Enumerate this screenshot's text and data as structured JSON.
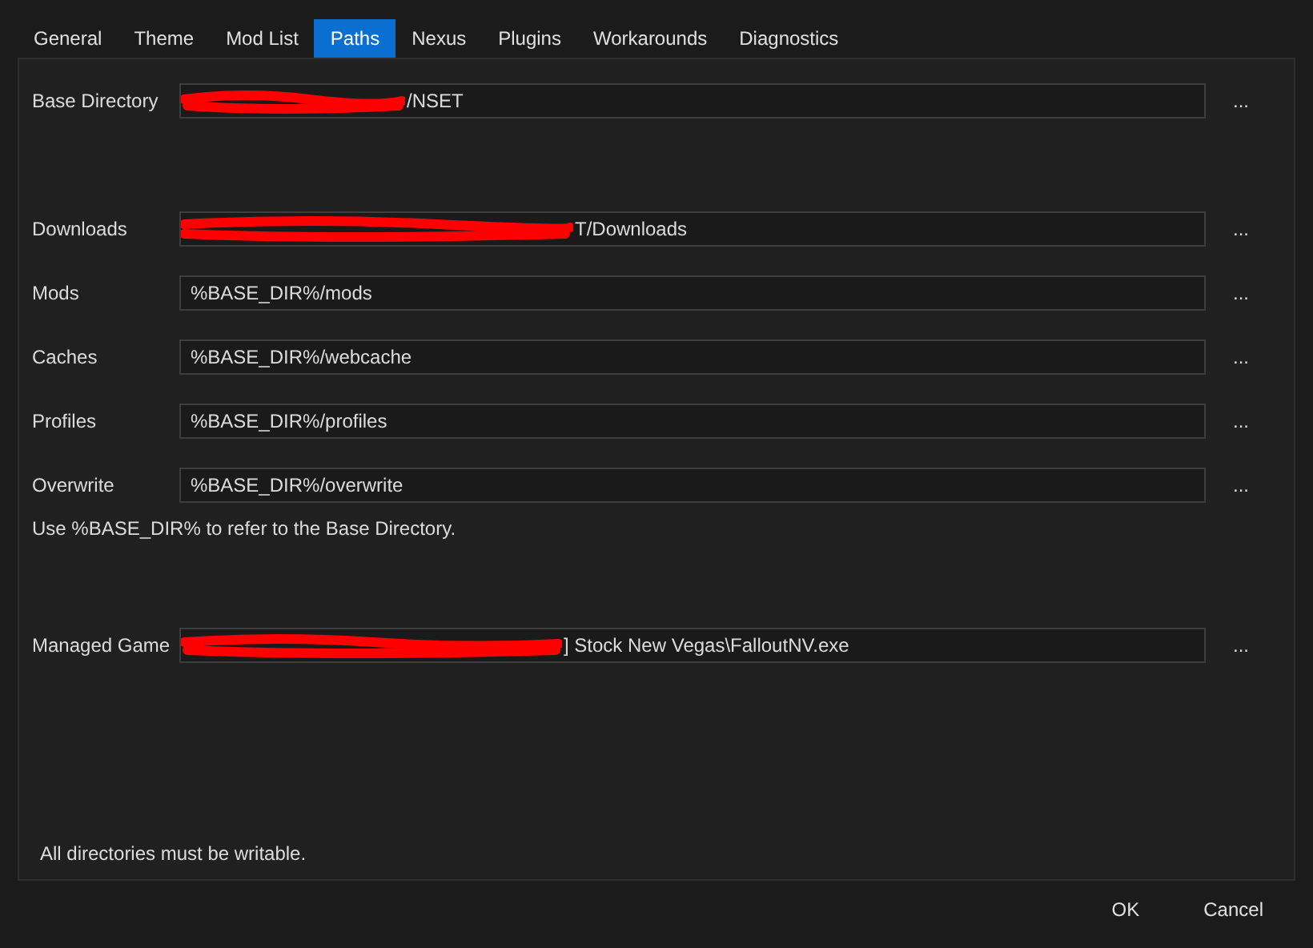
{
  "tabs": [
    {
      "label": "General",
      "selected": false
    },
    {
      "label": "Theme",
      "selected": false
    },
    {
      "label": "Mod List",
      "selected": false
    },
    {
      "label": "Paths",
      "selected": true
    },
    {
      "label": "Nexus",
      "selected": false
    },
    {
      "label": "Plugins",
      "selected": false
    },
    {
      "label": "Workarounds",
      "selected": false
    },
    {
      "label": "Diagnostics",
      "selected": false
    }
  ],
  "base_directory": {
    "label": "Base Directory",
    "value": "/NSET",
    "redacted": true,
    "browse": "..."
  },
  "paths": [
    {
      "label": "Downloads",
      "value": "T/Downloads",
      "redacted": true,
      "browse": "..."
    },
    {
      "label": "Mods",
      "value": "%BASE_DIR%/mods",
      "redacted": false,
      "browse": "..."
    },
    {
      "label": "Caches",
      "value": "%BASE_DIR%/webcache",
      "redacted": false,
      "browse": "..."
    },
    {
      "label": "Profiles",
      "value": "%BASE_DIR%/profiles",
      "redacted": false,
      "browse": "..."
    },
    {
      "label": "Overwrite",
      "value": "%BASE_DIR%/overwrite",
      "redacted": false,
      "browse": "..."
    }
  ],
  "hint": "Use %BASE_DIR% to refer to the Base Directory.",
  "managed_game": {
    "label": "Managed Game",
    "value": "] Stock New Vegas\\FalloutNV.exe",
    "redacted": true,
    "browse": "..."
  },
  "footer_note": "All directories must be writable.",
  "buttons": [
    "OK",
    "Cancel"
  ]
}
